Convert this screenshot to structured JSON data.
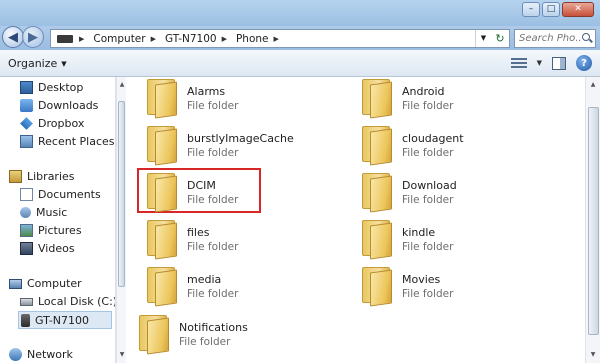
{
  "window": {
    "minimize_glyph": "–",
    "maximize_glyph": "□",
    "close_glyph": "✕"
  },
  "nav": {
    "back_glyph": "◀",
    "forward_glyph": "▶",
    "breadcrumbs": [
      "Computer",
      "GT-N7100",
      "Phone"
    ],
    "crumb_sep": "▶",
    "dropdown_glyph": "▼",
    "refresh_glyph": "↻",
    "search_placeholder": "Search Pho..."
  },
  "toolbar": {
    "organize_label": "Organize",
    "dropdown_glyph": "▼",
    "help_glyph": "?"
  },
  "sidebar": {
    "favorites": [
      "Desktop",
      "Downloads",
      "Dropbox",
      "Recent Places"
    ],
    "libraries_header": "Libraries",
    "libraries": [
      "Documents",
      "Music",
      "Pictures",
      "Videos"
    ],
    "computer_header": "Computer",
    "drives": [
      "Local Disk (C:)",
      "GT-N7100"
    ],
    "network_header": "Network",
    "selected": "GT-N7100"
  },
  "folders": [
    {
      "name": "Alarms",
      "type": "File folder"
    },
    {
      "name": "Android",
      "type": "File folder"
    },
    {
      "name": "burstlyImageCache",
      "type": "File folder"
    },
    {
      "name": "cloudagent",
      "type": "File folder"
    },
    {
      "name": "DCIM",
      "type": "File folder",
      "highlighted": true
    },
    {
      "name": "Download",
      "type": "File folder"
    },
    {
      "name": "files",
      "type": "File folder"
    },
    {
      "name": "kindle",
      "type": "File folder"
    },
    {
      "name": "media",
      "type": "File folder"
    },
    {
      "name": "Movies",
      "type": "File folder"
    },
    {
      "name": "Notifications",
      "type": "File folder"
    }
  ],
  "colors": {
    "highlight_border": "#d92727",
    "folder_yellow": "#ecc65c",
    "chrome_blue": "#9bbde2"
  }
}
